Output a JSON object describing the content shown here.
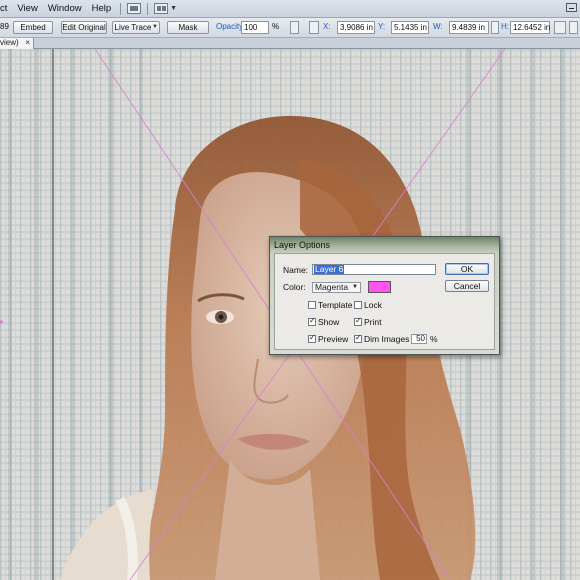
{
  "menubar": {
    "items": [
      "ct",
      "View",
      "Window",
      "Help"
    ],
    "icons": [
      "bridge-icon",
      "arrange-documents-icon"
    ]
  },
  "control": {
    "partial_label": "89",
    "embed": "Embed",
    "edit_original": "Edit Original",
    "live_trace": "Live Trace",
    "mask": "Mask",
    "opacity_label": "Opacity:",
    "opacity_value": "100",
    "opacity_unit": "%",
    "x_label": "X:",
    "x_value": "3.9086 in",
    "y_label": "Y:",
    "y_value": "5.1435 in",
    "w_label": "W:",
    "w_value": "9.4839 in",
    "h_label": "H:",
    "h_value": "12.6452 in"
  },
  "tab": {
    "label": "view)",
    "close": "×"
  },
  "dialog": {
    "title": "Layer Options",
    "name_label": "Name:",
    "name_value": "Layer 6",
    "color_label": "Color:",
    "color_value": "Magenta",
    "swatch_color": "#ff55ee",
    "ok": "OK",
    "cancel": "Cancel",
    "template": "Template",
    "lock": "Lock",
    "show": "Show",
    "print": "Print",
    "preview": "Preview",
    "dim_images": "Dim Images to:",
    "dim_value": "50",
    "dim_unit": "%",
    "checked": {
      "template": false,
      "lock": false,
      "show": true,
      "print": true,
      "preview": true,
      "dim_images": true
    }
  },
  "colors": {
    "guide": "#d97fd0",
    "hair": "#a35a2e",
    "skin": "#dab7a0"
  }
}
